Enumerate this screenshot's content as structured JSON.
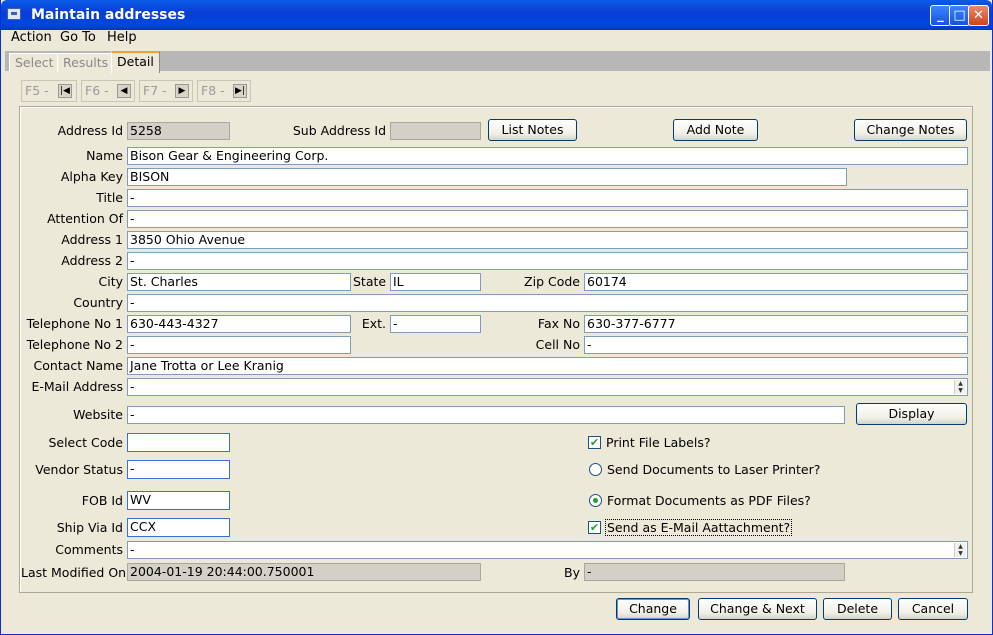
{
  "window": {
    "title": "Maintain addresses"
  },
  "menu": {
    "action": "Action",
    "goto": "Go To",
    "help": "Help"
  },
  "tabs": {
    "select": "Select",
    "results": "Results",
    "detail": "Detail"
  },
  "nav": {
    "f5": "F5 -",
    "f6": "F6 -",
    "f7": "F7 -",
    "f8": "F8 -"
  },
  "labels": {
    "address_id": "Address Id",
    "sub_address_id": "Sub Address Id",
    "name": "Name",
    "alpha_key": "Alpha Key",
    "title": "Title",
    "attention_of": "Attention Of",
    "address1": "Address 1",
    "address2": "Address 2",
    "city": "City",
    "state": "State",
    "zip": "Zip Code",
    "country": "Country",
    "phone1": "Telephone No 1",
    "ext": "Ext.",
    "fax": "Fax No",
    "phone2": "Telephone No 2",
    "cell": "Cell No",
    "contact": "Contact Name",
    "email": "E-Mail Address",
    "website": "Website",
    "select_code": "Select Code",
    "vendor_status": "Vendor Status",
    "fob_id": "FOB Id",
    "ship_via_id": "Ship Via Id",
    "comments": "Comments",
    "last_modified": "Last Modified On",
    "by": "By"
  },
  "values": {
    "address_id": "5258",
    "sub_address_id": "",
    "name": "Bison Gear & Engineering Corp.",
    "alpha_key": "BISON",
    "title": "-",
    "attention_of": "-",
    "address1": "3850 Ohio Avenue",
    "address2": "-",
    "city": "St. Charles",
    "state": "IL",
    "zip": "60174",
    "country": "-",
    "phone1": "630-443-4327",
    "ext": "-",
    "fax": "630-377-6777",
    "phone2": "-",
    "cell": "-",
    "contact": "Jane Trotta or Lee Kranig",
    "email": "-",
    "website": "-",
    "select_code": "",
    "vendor_status": "-",
    "fob_id": "WV",
    "ship_via_id": "CCX",
    "comments": "-",
    "last_modified": "2004-01-19 20:44:00.750001",
    "by": "-"
  },
  "buttons": {
    "list_notes": "List Notes",
    "add_note": "Add Note",
    "change_notes": "Change Notes",
    "display": "Display",
    "change": "Change",
    "change_next": "Change & Next",
    "delete": "Delete",
    "cancel": "Cancel"
  },
  "options": {
    "print_labels": {
      "label": "Print File Labels?",
      "checked": true
    },
    "laser": {
      "label": "Send Documents to Laser Printer?",
      "selected": false
    },
    "pdf": {
      "label": "Format Documents as PDF Files?",
      "selected": true
    },
    "email_attach": {
      "label": "Send as E-Mail Aattachment?",
      "checked": true
    }
  }
}
